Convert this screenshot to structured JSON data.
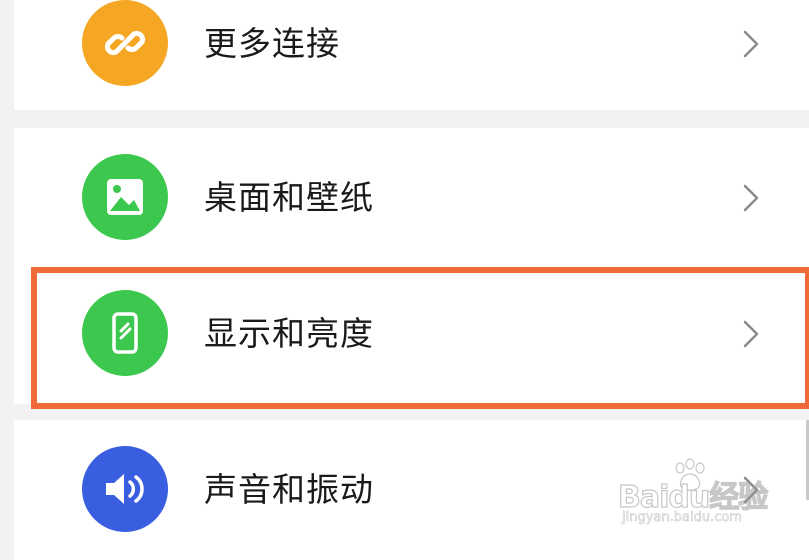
{
  "settings": {
    "items": [
      {
        "label": "更多连接",
        "icon": "link-icon",
        "color": "#f5a623"
      },
      {
        "label": "桌面和壁纸",
        "icon": "image-icon",
        "color": "#3cc84e"
      },
      {
        "label": "显示和亮度",
        "icon": "phone-brightness-icon",
        "color": "#3cc84e"
      },
      {
        "label": "声音和振动",
        "icon": "speaker-icon",
        "color": "#3a5ee0"
      }
    ],
    "highlight_color": "#f0693b"
  },
  "watermark": {
    "brand": "Baidu经验",
    "url": "jingyan.baidu.com"
  }
}
